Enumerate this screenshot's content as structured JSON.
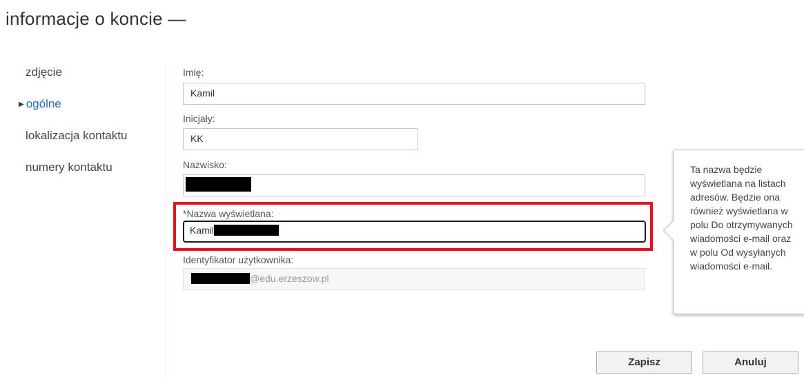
{
  "page": {
    "title": "informacje o koncie —"
  },
  "nav": {
    "items": [
      {
        "label": "zdjęcie",
        "active": false
      },
      {
        "label": "ogólne",
        "active": true
      },
      {
        "label": "lokalizacja kontaktu",
        "active": false
      },
      {
        "label": "numery kontaktu",
        "active": false
      }
    ]
  },
  "form": {
    "first_name": {
      "label": "Imię:",
      "value": "Kamil"
    },
    "initials": {
      "label": "Inicjały:",
      "value": "KK"
    },
    "last_name": {
      "label": "Nazwisko:",
      "value": ""
    },
    "display_name": {
      "label": "*Nazwa wyświetlana:",
      "value_prefix": "Kamil"
    },
    "user_id": {
      "label": "Identyfikator użytkownika:",
      "domain": "@edu.erzeszow.pl"
    }
  },
  "tooltip": {
    "text": "Ta nazwa będzie wyświetlana na listach adresów. Będzie ona również wyświetlana w polu Do otrzymywanych wiadomości e-mail oraz w polu Od wysyłanych wiadomości e-mail."
  },
  "buttons": {
    "save": "Zapisz",
    "cancel": "Anuluj"
  },
  "colors": {
    "active_nav": "#2a6ebb",
    "highlight": "#e3141c"
  }
}
